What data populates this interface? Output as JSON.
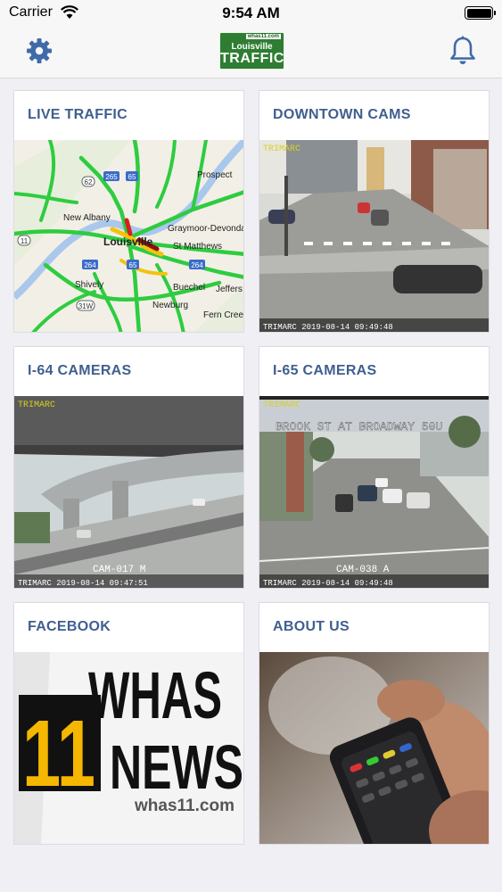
{
  "status_bar": {
    "carrier": "Carrier",
    "time": "9:54 AM",
    "icons": [
      "wifi-icon",
      "battery-icon"
    ]
  },
  "nav": {
    "settings_icon": "gear-icon",
    "notifications_icon": "bell-icon",
    "logo": {
      "site": "whas11.com",
      "city": "Louisville",
      "word": "TRAFFIC"
    }
  },
  "tiles": [
    {
      "title": "LIVE TRAFFIC",
      "map_labels": {
        "prospect": "Prospect",
        "new_albany": "New Albany",
        "louisville": "Louisville",
        "graymoor": "Graymoor-Devonda",
        "st_matthews": "St Matthews",
        "shively": "Shively",
        "buechel": "Buechel",
        "jeffers": "Jeffers",
        "newburg": "Newburg",
        "fern_creek": "Fern Cree",
        "r62": "62",
        "r265": "265",
        "r65": "65",
        "r11": "11",
        "r264": "264",
        "r31w": "31W"
      }
    },
    {
      "title": "DOWNTOWN CAMS",
      "watermark": "TRIMARC",
      "timestamp": "TRIMARC 2019-08-14 09:49:48"
    },
    {
      "title": "I-64 CAMERAS",
      "watermark": "TRIMARC",
      "cam_id": "CAM-017 M",
      "timestamp": "TRIMARC 2019-08-14 09:47:51"
    },
    {
      "title": "I-65 CAMERAS",
      "watermark": "TRIMARC",
      "location": "BROOK ST AT BROADWAY 50U",
      "cam_id": "CAM-038 A",
      "timestamp": "TRIMARC 2019-08-14 09:49:48"
    },
    {
      "title": "FACEBOOK",
      "brand_top": "WHAS",
      "brand_number": "11",
      "brand_bottom": "NEWS",
      "brand_site": "whas11.com"
    },
    {
      "title": "ABOUT US"
    }
  ],
  "colors": {
    "title_blue": "#3f5f8f",
    "traffic_green": "#2e7d32",
    "road_green": "#2ecc40",
    "road_yellow": "#f4c20d",
    "road_red": "#d62020",
    "whas_yellow": "#f5b700"
  }
}
